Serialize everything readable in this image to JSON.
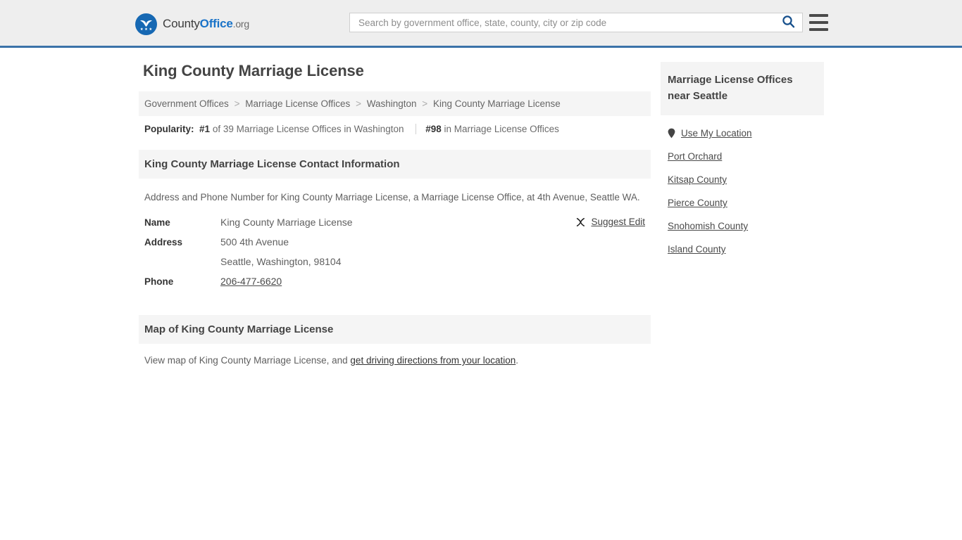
{
  "header": {
    "logo": {
      "icon": "eagle-stars-emblem",
      "text_part1": "County",
      "text_part2": "Office",
      "text_part3": ".org"
    },
    "search": {
      "placeholder": "Search by government office, state, county, city or zip code",
      "value": "",
      "icon": "search-icon"
    },
    "menu_icon": "hamburger-menu-icon",
    "accent_color": "#3b72a8",
    "background_color": "#eeeeee"
  },
  "main": {
    "title": "King County Marriage License",
    "breadcrumb": {
      "separator": ">",
      "items": [
        {
          "label": "Government Offices"
        },
        {
          "label": "Marriage License Offices"
        },
        {
          "label": "Washington"
        },
        {
          "label": "King County Marriage License"
        }
      ]
    },
    "popularity": {
      "label": "Popularity:",
      "state_rank": "#1",
      "state_text": "of 39 Marriage License Offices in Washington",
      "national_rank": "#98",
      "national_text": "in Marriage License Offices"
    },
    "contact": {
      "section_title": "King County Marriage License Contact Information",
      "intro": "Address and Phone Number for King County Marriage License, a Marriage License Office, at 4th Avenue, Seattle WA.",
      "rows": [
        {
          "key": "Name",
          "value": "King County Marriage License"
        },
        {
          "key": "Address",
          "value": "500 4th Avenue"
        },
        {
          "key": "",
          "value": "Seattle, Washington, 98104"
        },
        {
          "key": "Phone",
          "value": "206-477-6620"
        }
      ],
      "name_key": "Name",
      "name_value": "King County Marriage License",
      "address_key": "Address",
      "address_line1": "500 4th Avenue",
      "address_line2": "Seattle, Washington, 98104",
      "phone_key": "Phone",
      "phone_value": "206-477-6620",
      "suggest_edit_label": "Suggest Edit",
      "suggest_edit_icon": "edit-pencil-icon"
    },
    "map": {
      "section_title": "Map of King County Marriage License",
      "note_prefix": "View map of King County Marriage License, and ",
      "note_link": "get driving directions from your location",
      "note_suffix": "."
    }
  },
  "sidebar": {
    "title": "Marriage License Offices near Seattle",
    "use_my_location": {
      "label": "Use My Location",
      "icon": "map-pin-icon"
    },
    "items": [
      {
        "label": "Port Orchard"
      },
      {
        "label": "Kitsap County"
      },
      {
        "label": "Pierce County"
      },
      {
        "label": "Snohomish County"
      },
      {
        "label": "Island County"
      }
    ]
  }
}
